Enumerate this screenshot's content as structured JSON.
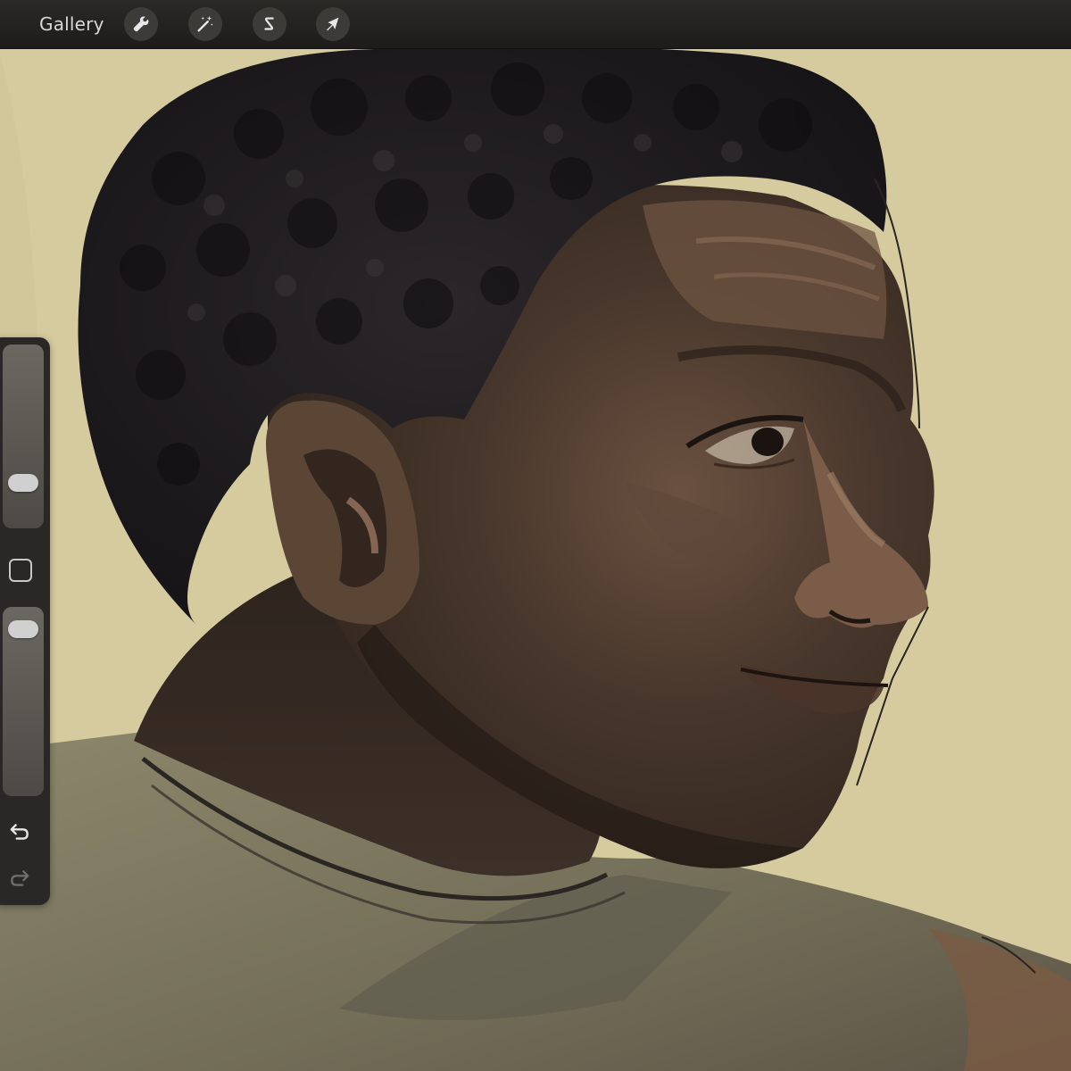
{
  "toolbar": {
    "gallery_label": "Gallery",
    "tools": [
      {
        "name": "actions",
        "icon": "wrench-icon"
      },
      {
        "name": "adjustments",
        "icon": "magic-wand-icon"
      },
      {
        "name": "selection",
        "icon": "selection-s-icon"
      },
      {
        "name": "transform",
        "icon": "arrow-cursor-icon"
      }
    ]
  },
  "sidebar": {
    "brush_size_level": 0.2,
    "opacity_level": 0.95,
    "modify_icon": "square-icon",
    "undo_icon": "undo-icon",
    "redo_icon": "redo-icon",
    "redo_enabled": false
  },
  "colors": {
    "toolbar_bg": "#262422",
    "canvas_bg": "#d5cb9f",
    "skin_dark": "#3b2c23",
    "skin_mid": "#5a4433",
    "skin_light": "#8a6c54",
    "hair": "#1d1b1d",
    "shirt": "#7f7a62"
  }
}
